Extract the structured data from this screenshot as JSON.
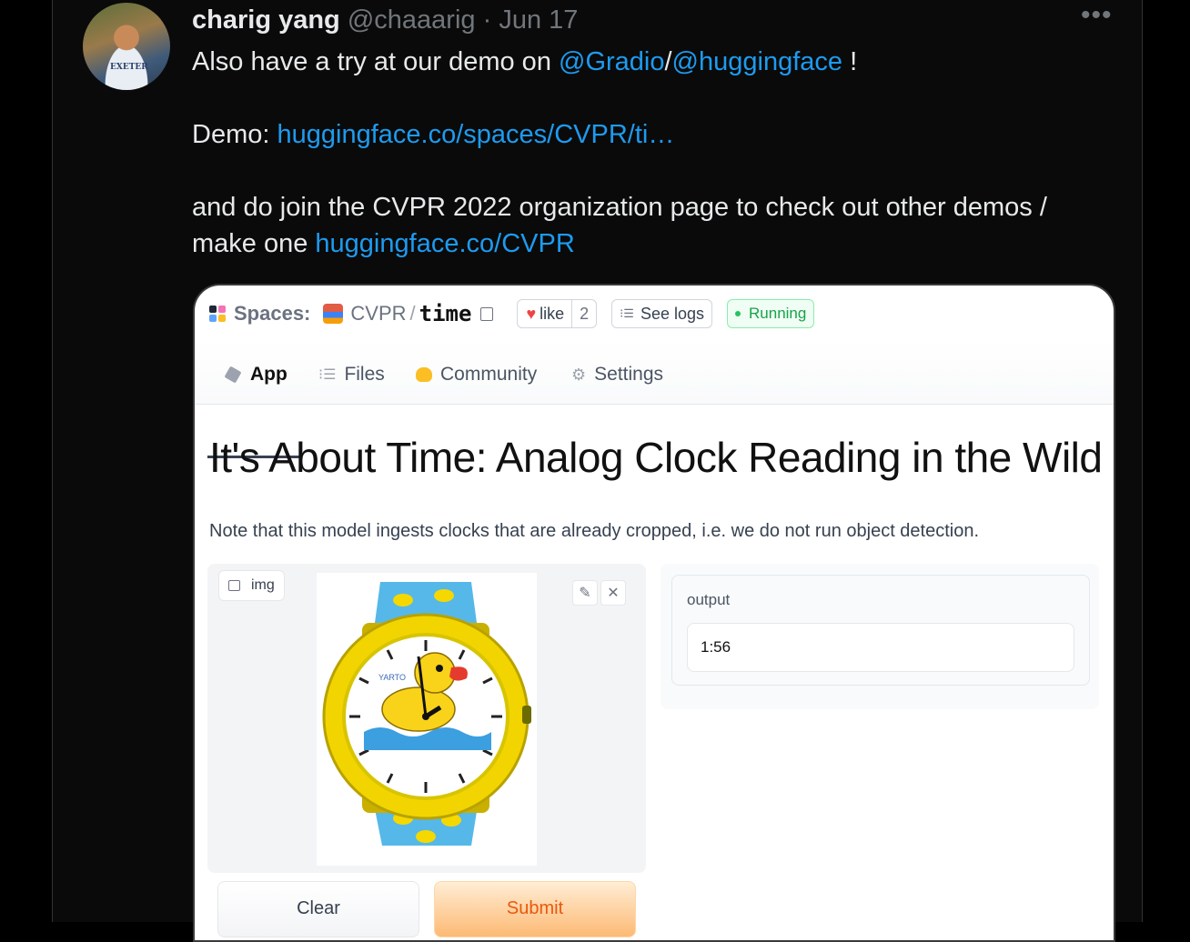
{
  "tweet": {
    "author_name": "charig yang",
    "author_handle": "@chaaarig",
    "separator": "·",
    "date": "Jun 17",
    "more": "•••",
    "avatar_shirt_text": "EXETER",
    "line1_prefix": "Also have a try at our demo on ",
    "line1_link1": "@Gradio",
    "line1_slash": "/",
    "line1_link2": "@huggingface",
    "line1_suffix": " !",
    "line2_prefix": "Demo: ",
    "line2_link": "huggingface.co/spaces/CVPR/ti…",
    "line3": "and do join the CVPR 2022 organization page to check out other demos /",
    "line4_prefix": "make one ",
    "line4_link": "huggingface.co/CVPR"
  },
  "spaces": {
    "label": "Spaces:",
    "org": "CVPR",
    "slash": "/",
    "space": "time",
    "like_label": "like",
    "like_count": "2",
    "logs_label": "See logs",
    "status": "Running"
  },
  "tabs": [
    {
      "label": "App"
    },
    {
      "label": "Files"
    },
    {
      "label": "Community"
    },
    {
      "label": "Settings"
    }
  ],
  "app": {
    "title": "It's About Time: Analog Clock Reading in the Wild",
    "note": "Note that this model ingests clocks that are already cropped, i.e. we do not run object detection.",
    "input_label": "img",
    "output_label": "output",
    "output_value": "1:56",
    "clear_label": "Clear",
    "submit_label": "Submit",
    "watch_brand": "YARTO"
  },
  "colors": {
    "link": "#1d9bf0",
    "running": "#16a34a",
    "submit": "#ea580c",
    "watch_case": "#f5d800",
    "strap": "#56b8e8"
  }
}
